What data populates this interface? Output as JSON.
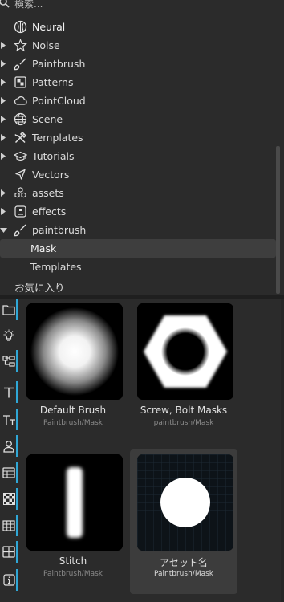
{
  "search": {
    "placeholder": "検索..."
  },
  "tree": {
    "items": [
      {
        "label": "Neural",
        "icon": "brain-icon",
        "arrow": false
      },
      {
        "label": "Noise",
        "icon": "star-outline-icon",
        "arrow": true
      },
      {
        "label": "Paintbrush",
        "icon": "paintbrush-icon",
        "arrow": true
      },
      {
        "label": "Patterns",
        "icon": "pattern-icon",
        "arrow": true
      },
      {
        "label": "PointCloud",
        "icon": "cloud-icon",
        "arrow": true
      },
      {
        "label": "Scene",
        "icon": "globe-icon",
        "arrow": true
      },
      {
        "label": "Templates",
        "icon": "tools-icon",
        "arrow": true
      },
      {
        "label": "Tutorials",
        "icon": "graduation-cap-icon",
        "arrow": true
      },
      {
        "label": "Vectors",
        "icon": "cursor-arrow-icon",
        "arrow": false
      },
      {
        "label": "assets",
        "icon": "cubes-icon",
        "arrow": true
      },
      {
        "label": "effects",
        "icon": "effects-icon",
        "arrow": true
      },
      {
        "label": "paintbrush",
        "icon": "paintbrush-icon",
        "arrow": "open"
      }
    ],
    "children": [
      {
        "label": "Mask",
        "selected": true
      },
      {
        "label": "Templates",
        "selected": false
      }
    ],
    "favorites_label": "お気に入り"
  },
  "toolbar": {
    "tools": [
      "folder-icon",
      "lightbulb-icon",
      "hierarchy-icon",
      "text-icon",
      "text-size-icon",
      "person-icon",
      "table-icon",
      "checkerboard-icon",
      "grid-icon",
      "grid-border-icon",
      "info-icon"
    ]
  },
  "grid": {
    "cards": [
      {
        "name": "Default Brush",
        "path": "Paintbrush/Mask",
        "selected": false
      },
      {
        "name": "Screw, Bolt Masks",
        "path": "paintbrush/Mask",
        "selected": false
      },
      {
        "name": "Stitch",
        "path": "Paintbrush/Mask",
        "selected": false
      },
      {
        "name": "アセット名",
        "path": "Paintbrush/Mask",
        "selected": true
      }
    ]
  },
  "colors": {
    "accent": "#2fa7d6",
    "background": "#2b2b2b",
    "selected": "#3e3e3e"
  }
}
